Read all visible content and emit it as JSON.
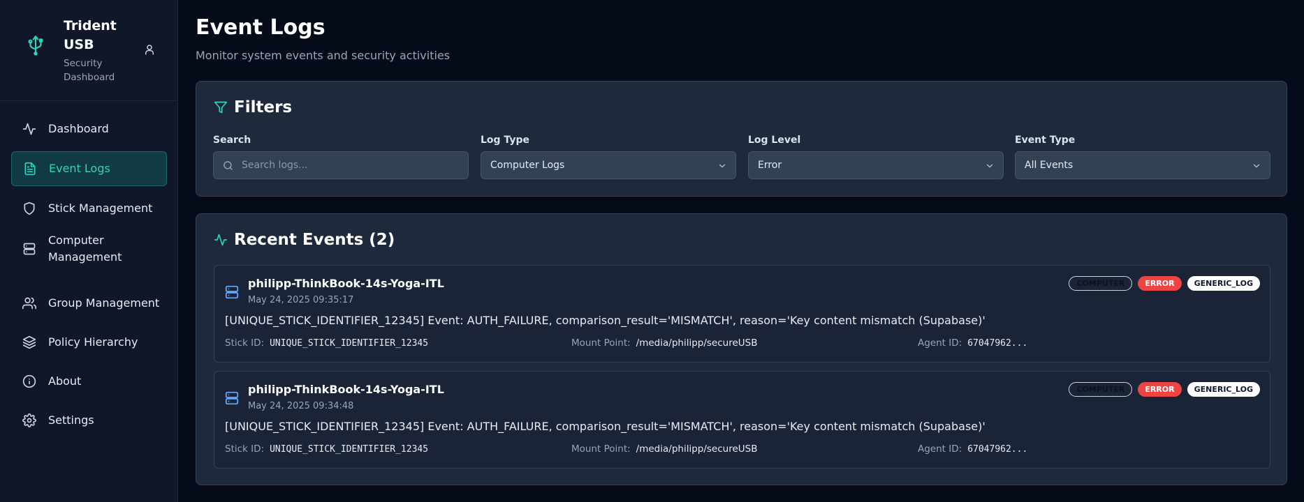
{
  "app": {
    "name": "Trident USB",
    "subtitle": "Security Dashboard"
  },
  "sidebar": {
    "items": [
      {
        "label": "Dashboard",
        "icon": "activity-icon",
        "active": false
      },
      {
        "label": "Event Logs",
        "icon": "file-text-icon",
        "active": true
      },
      {
        "label": "Stick Management",
        "icon": "shield-icon",
        "active": false
      },
      {
        "label": "Computer Management",
        "icon": "server-icon",
        "active": false
      },
      {
        "label": "Group Management",
        "icon": "users-icon",
        "active": false
      },
      {
        "label": "Policy Hierarchy",
        "icon": "layers-icon",
        "active": false
      },
      {
        "label": "About",
        "icon": "info-icon",
        "active": false
      },
      {
        "label": "Settings",
        "icon": "gear-icon",
        "active": false
      }
    ]
  },
  "page": {
    "title": "Event Logs",
    "subtitle": "Monitor system events and security activities"
  },
  "filters": {
    "title": "Filters",
    "search_label": "Search",
    "search_placeholder": "Search logs...",
    "log_type_label": "Log Type",
    "log_type_value": "Computer Logs",
    "log_level_label": "Log Level",
    "log_level_value": "Error",
    "event_type_label": "Event Type",
    "event_type_value": "All Events"
  },
  "events": {
    "title": "Recent Events (2)",
    "items": [
      {
        "host": "philipp-ThinkBook-14s-Yoga-ITL",
        "time": "May 24, 2025 09:35:17",
        "message": "[UNIQUE_STICK_IDENTIFIER_12345] Event: AUTH_FAILURE, comparison_result='MISMATCH', reason='Key content mismatch (Supabase)'",
        "badges": [
          "COMPUTER",
          "ERROR",
          "GENERIC_LOG"
        ],
        "stick_id_label": "Stick ID:",
        "stick_id": "UNIQUE_STICK_IDENTIFIER_12345",
        "mount_label": "Mount Point:",
        "mount": "/media/philipp/secureUSB",
        "agent_label": "Agent ID:",
        "agent": "67047962..."
      },
      {
        "host": "philipp-ThinkBook-14s-Yoga-ITL",
        "time": "May 24, 2025 09:34:48",
        "message": "[UNIQUE_STICK_IDENTIFIER_12345] Event: AUTH_FAILURE, comparison_result='MISMATCH', reason='Key content mismatch (Supabase)'",
        "badges": [
          "COMPUTER",
          "ERROR",
          "GENERIC_LOG"
        ],
        "stick_id_label": "Stick ID:",
        "stick_id": "UNIQUE_STICK_IDENTIFIER_12345",
        "mount_label": "Mount Point:",
        "mount": "/media/philipp/secureUSB",
        "agent_label": "Agent ID:",
        "agent": "67047962..."
      }
    ]
  },
  "colors": {
    "accent": "#2dd4bf",
    "error": "#ef4444",
    "server_icon": "#60a5fa"
  }
}
